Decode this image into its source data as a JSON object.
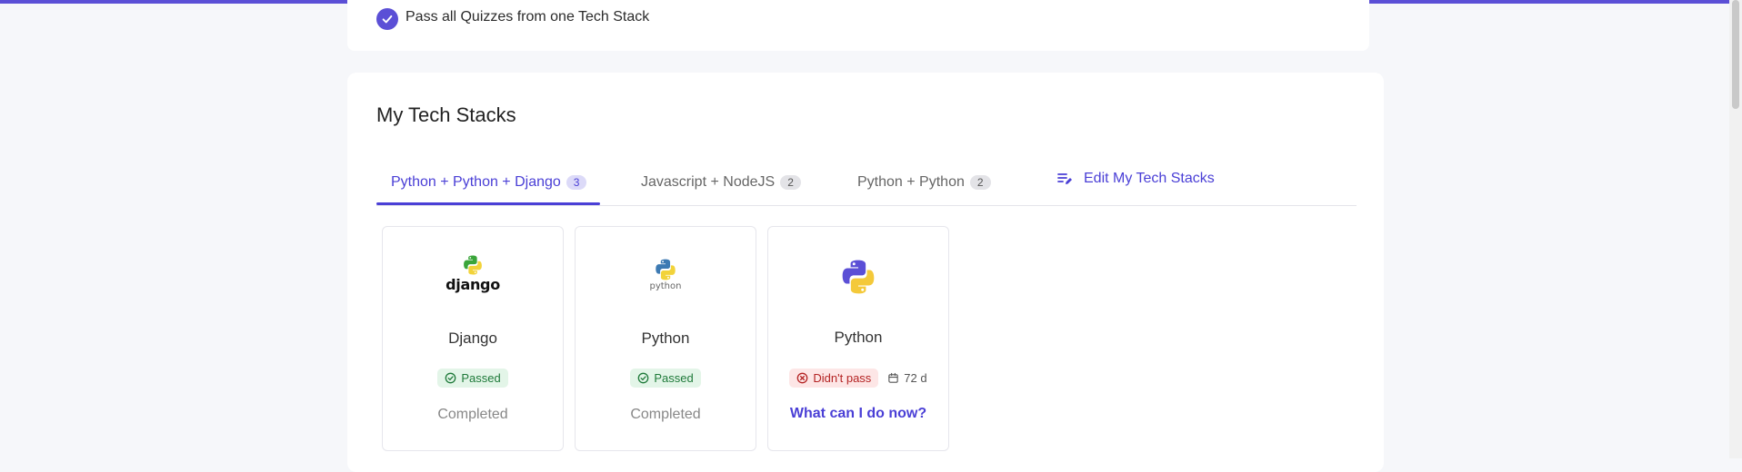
{
  "achievement": {
    "text": "Pass all Quizzes from one Tech Stack"
  },
  "section": {
    "title": "My Tech Stacks"
  },
  "tabs": [
    {
      "label": "Python + Python + Django",
      "count": "3",
      "active": true
    },
    {
      "label": "Javascript + NodeJS",
      "count": "2",
      "active": false
    },
    {
      "label": "Python + Python",
      "count": "2",
      "active": false
    }
  ],
  "edit_link": {
    "label": "Edit My Tech Stacks",
    "icon": "edit-list-icon"
  },
  "stack_cards": [
    {
      "name": "Django",
      "logo": "django-logo",
      "logo_text": "django",
      "status": "Passed",
      "footer": "Completed"
    },
    {
      "name": "Python",
      "logo": "python-logo",
      "logo_text": "python",
      "status": "Passed",
      "footer": "Completed"
    },
    {
      "name": "Python",
      "logo": "python-logo",
      "status": "Didn't pass",
      "days": "72 d",
      "action": "What can I do now?"
    }
  ],
  "colors": {
    "accent": "#5b4fd6",
    "pass": "#1f7a3a",
    "fail": "#b42323"
  }
}
